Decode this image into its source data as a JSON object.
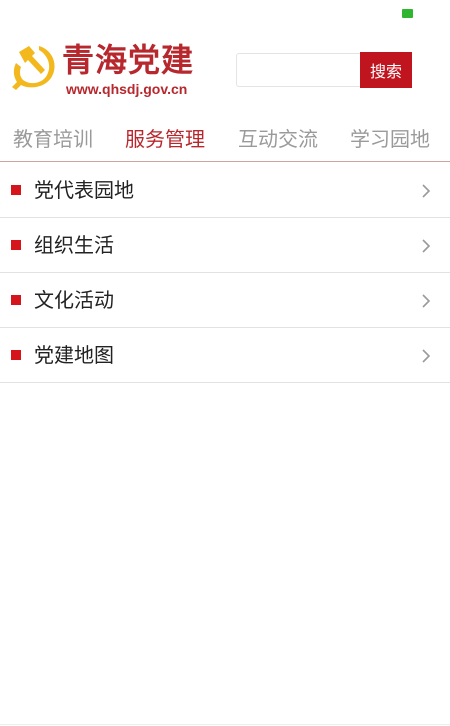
{
  "colors": {
    "brand_red": "#b7282e",
    "search_red": "#c0141f",
    "bullet_red": "#d6141c",
    "emblem_yellow": "#f2b81d",
    "tab_inactive": "#9a9a9a",
    "battery_green": "#2fb52f"
  },
  "header": {
    "logo_title": "青海党建",
    "logo_url": "www.qhsdj.gov.cn",
    "logo_icon": "hammer-sickle-icon"
  },
  "search": {
    "value": "",
    "placeholder": "",
    "button_label": "搜索"
  },
  "tabs": [
    {
      "label": "教育培训",
      "active": false
    },
    {
      "label": "服务管理",
      "active": true
    },
    {
      "label": "互动交流",
      "active": false
    },
    {
      "label": "学习园地",
      "active": false
    }
  ],
  "menu": {
    "items": [
      {
        "label": "党代表园地"
      },
      {
        "label": "组织生活"
      },
      {
        "label": "文化活动"
      },
      {
        "label": "党建地图"
      }
    ],
    "chevron_icon": "chevron-right-icon"
  }
}
